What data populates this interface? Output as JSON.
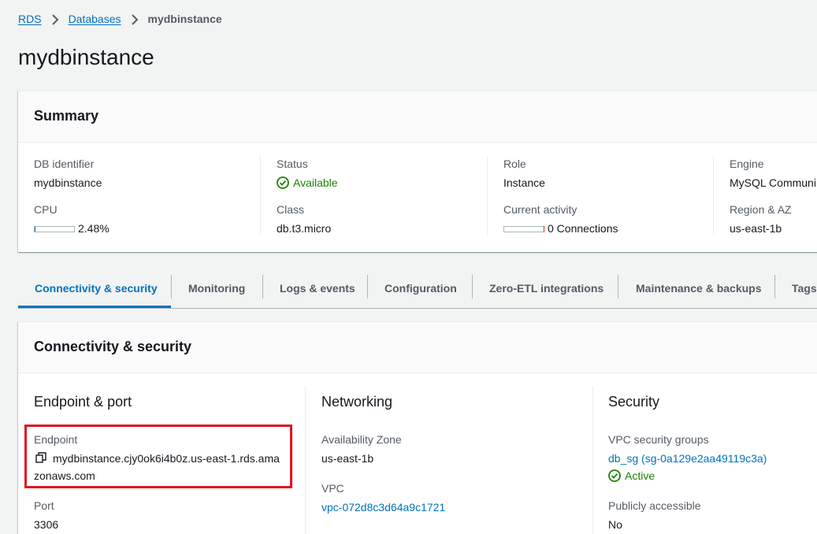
{
  "breadcrumb": {
    "items": [
      "RDS",
      "Databases"
    ],
    "current": "mydbinstance"
  },
  "page": {
    "title": "mydbinstance"
  },
  "summary": {
    "title": "Summary",
    "db_identifier": {
      "label": "DB identifier",
      "value": "mydbinstance"
    },
    "cpu": {
      "label": "CPU",
      "value": "2.48%",
      "fill_fraction": 0.0248
    },
    "status": {
      "label": "Status",
      "value": "Available"
    },
    "class": {
      "label": "Class",
      "value": "db.t3.micro"
    },
    "role": {
      "label": "Role",
      "value": "Instance"
    },
    "current_activity": {
      "label": "Current activity",
      "value": "0 Connections",
      "fill_fraction": 0
    },
    "engine": {
      "label": "Engine",
      "value": "MySQL Communi"
    },
    "region": {
      "label": "Region & AZ",
      "value": "us-east-1b"
    }
  },
  "tabs": [
    {
      "label": "Connectivity & security",
      "active": true
    },
    {
      "label": "Monitoring",
      "active": false
    },
    {
      "label": "Logs & events",
      "active": false
    },
    {
      "label": "Configuration",
      "active": false
    },
    {
      "label": "Zero-ETL integrations",
      "active": false
    },
    {
      "label": "Maintenance & backups",
      "active": false
    },
    {
      "label": "Tags",
      "active": false
    }
  ],
  "connectivity": {
    "title": "Connectivity & security",
    "endpoint_port": {
      "heading": "Endpoint & port",
      "endpoint_label": "Endpoint",
      "endpoint_line1": "mydbinstance.cjy0ok6i4b0z.us-east-1.rds.ama",
      "endpoint_line2": "zonaws.com",
      "port_label": "Port",
      "port_value": "3306"
    },
    "networking": {
      "heading": "Networking",
      "az_label": "Availability Zone",
      "az_value": "us-east-1b",
      "vpc_label": "VPC",
      "vpc_value": "vpc-072d8c3d64a9c1721"
    },
    "security": {
      "heading": "Security",
      "sg_label": "VPC security groups",
      "sg_value": "db_sg (sg-0a129e2aa49119c3a)",
      "sg_status": "Active",
      "public_label": "Publicly accessible",
      "public_value": "No"
    }
  },
  "colors": {
    "link": "#0073bb",
    "success": "#1d8102",
    "highlight": "#e0141e",
    "background": "#f2f3f3"
  }
}
